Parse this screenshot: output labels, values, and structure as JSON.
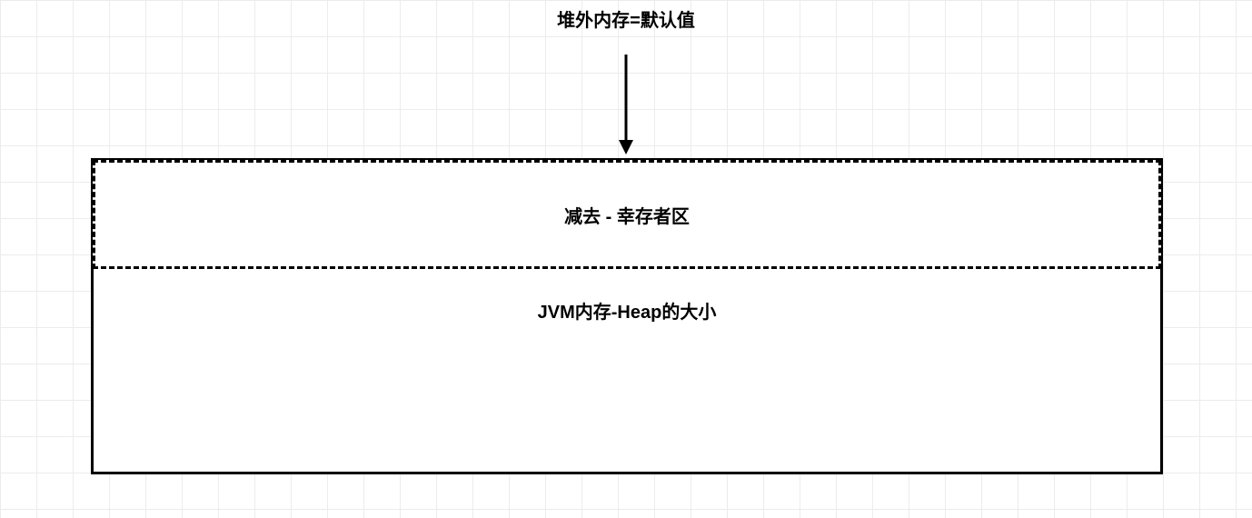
{
  "diagram": {
    "top_label": "堆外内存=默认值",
    "survivor_label": "减去 - 幸存者区",
    "heap_label": "JVM内存-Heap的大小"
  }
}
